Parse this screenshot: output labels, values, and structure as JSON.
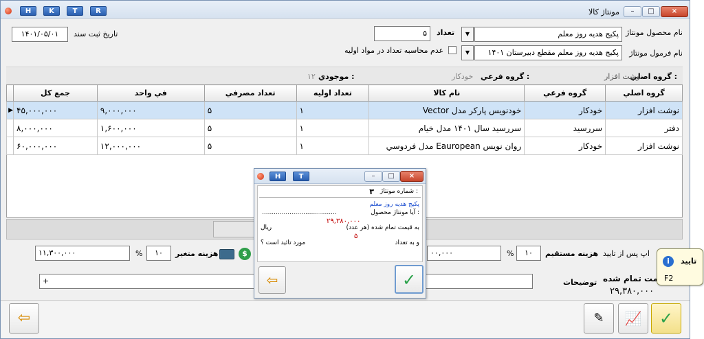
{
  "window": {
    "title": "مونتاژ کالا",
    "hotkeys": [
      "H",
      "K",
      "T",
      "R"
    ]
  },
  "header": {
    "product_label": "نام محصول مونتاژ",
    "product_value": "پکیج هدیه روز معلم",
    "formula_label": "نام فرمول مونتاژ",
    "formula_value": "پکیج هدیه روز معلم مقطع دبیرستان ۱۴۰۱",
    "qty_label": "تعداد",
    "qty_value": "۵",
    "no_calc_label": "عدم محاسبه تعداد در مواد اولیه",
    "date_label": "تاریخ ثبت سند",
    "date_value": "۱۴۰۱/۰۵/۰۱"
  },
  "filter": {
    "main_group_label": "گروه اصلي :",
    "main_group_value": "نوشت افزار",
    "sub_group_label": "گروه فرعي :",
    "sub_group_value": "خودکار",
    "stock_label": "موجودي :",
    "stock_value": "۱۲"
  },
  "table": {
    "headers": [
      "گروه اصلي",
      "گروه فرعي",
      "نام کالا",
      "تعداد اولیه",
      "تعداد مصرفي",
      "في واحد",
      "جمع کل"
    ],
    "rows": [
      [
        "نوشت افزار",
        "خودکار",
        "خودنویس پارکر مدل Vector",
        "۱",
        "۵",
        "۹,۰۰۰,۰۰۰",
        "۴۵,۰۰۰,۰۰۰"
      ],
      [
        "دفتر",
        "سررسید",
        "سررسید سال ۱۴۰۱ مدل خیام",
        "۱",
        "۵",
        "۱,۶۰۰,۰۰۰",
        "۸,۰۰۰,۰۰۰"
      ],
      [
        "نوشت افزار",
        "خودکار",
        "روان نویس Eauropean مدل فردوسي",
        "۱",
        "۵",
        "۱۲,۰۰۰,۰۰۰",
        "۶۰,۰۰۰,۰۰۰"
      ]
    ]
  },
  "costs": {
    "direct_label": "هزینه مستقیم",
    "direct_percent": "۱۰",
    "direct_amount": "۰۰,۰۰۰",
    "variable_label": "هزینه متغیر",
    "variable_percent": "۱۰",
    "variable_amount": "۱۱,۳۰۰,۰۰۰",
    "percent_sign": "%",
    "print_label": "اپ پس از تایید",
    "notes_label": "توضیحات",
    "notes_value": "+",
    "final_label": "یمت تمام شده",
    "final_value": "۲۹,۳۸۰,۰۰۰"
  },
  "dialog": {
    "hotkeys": [
      "H",
      "T"
    ],
    "number_label": "شماره مونتاژ :",
    "number_value": "۳",
    "product_value": "پکیج هدیه روز معلم",
    "question_1": "آیا مونتاژ محصول :",
    "price_value": "۲۹,۳۸۰,۰۰۰",
    "question_2": "به قیمت تمام شده (هر عدد)",
    "currency": "ریال",
    "qty_value": "۵",
    "question_3": "و به تعداد",
    "question_4": "مورد تائید است ؟",
    "dots": "......................................"
  },
  "tooltip": {
    "title": "تایید",
    "shortcut": "F2"
  },
  "colors": {
    "accent": "#2a5fb0",
    "confirm_green": "#2aa14a",
    "price_red": "#c00000",
    "dialog_blue": "#1d4fd0",
    "selected_row": "#cfe3f7"
  }
}
